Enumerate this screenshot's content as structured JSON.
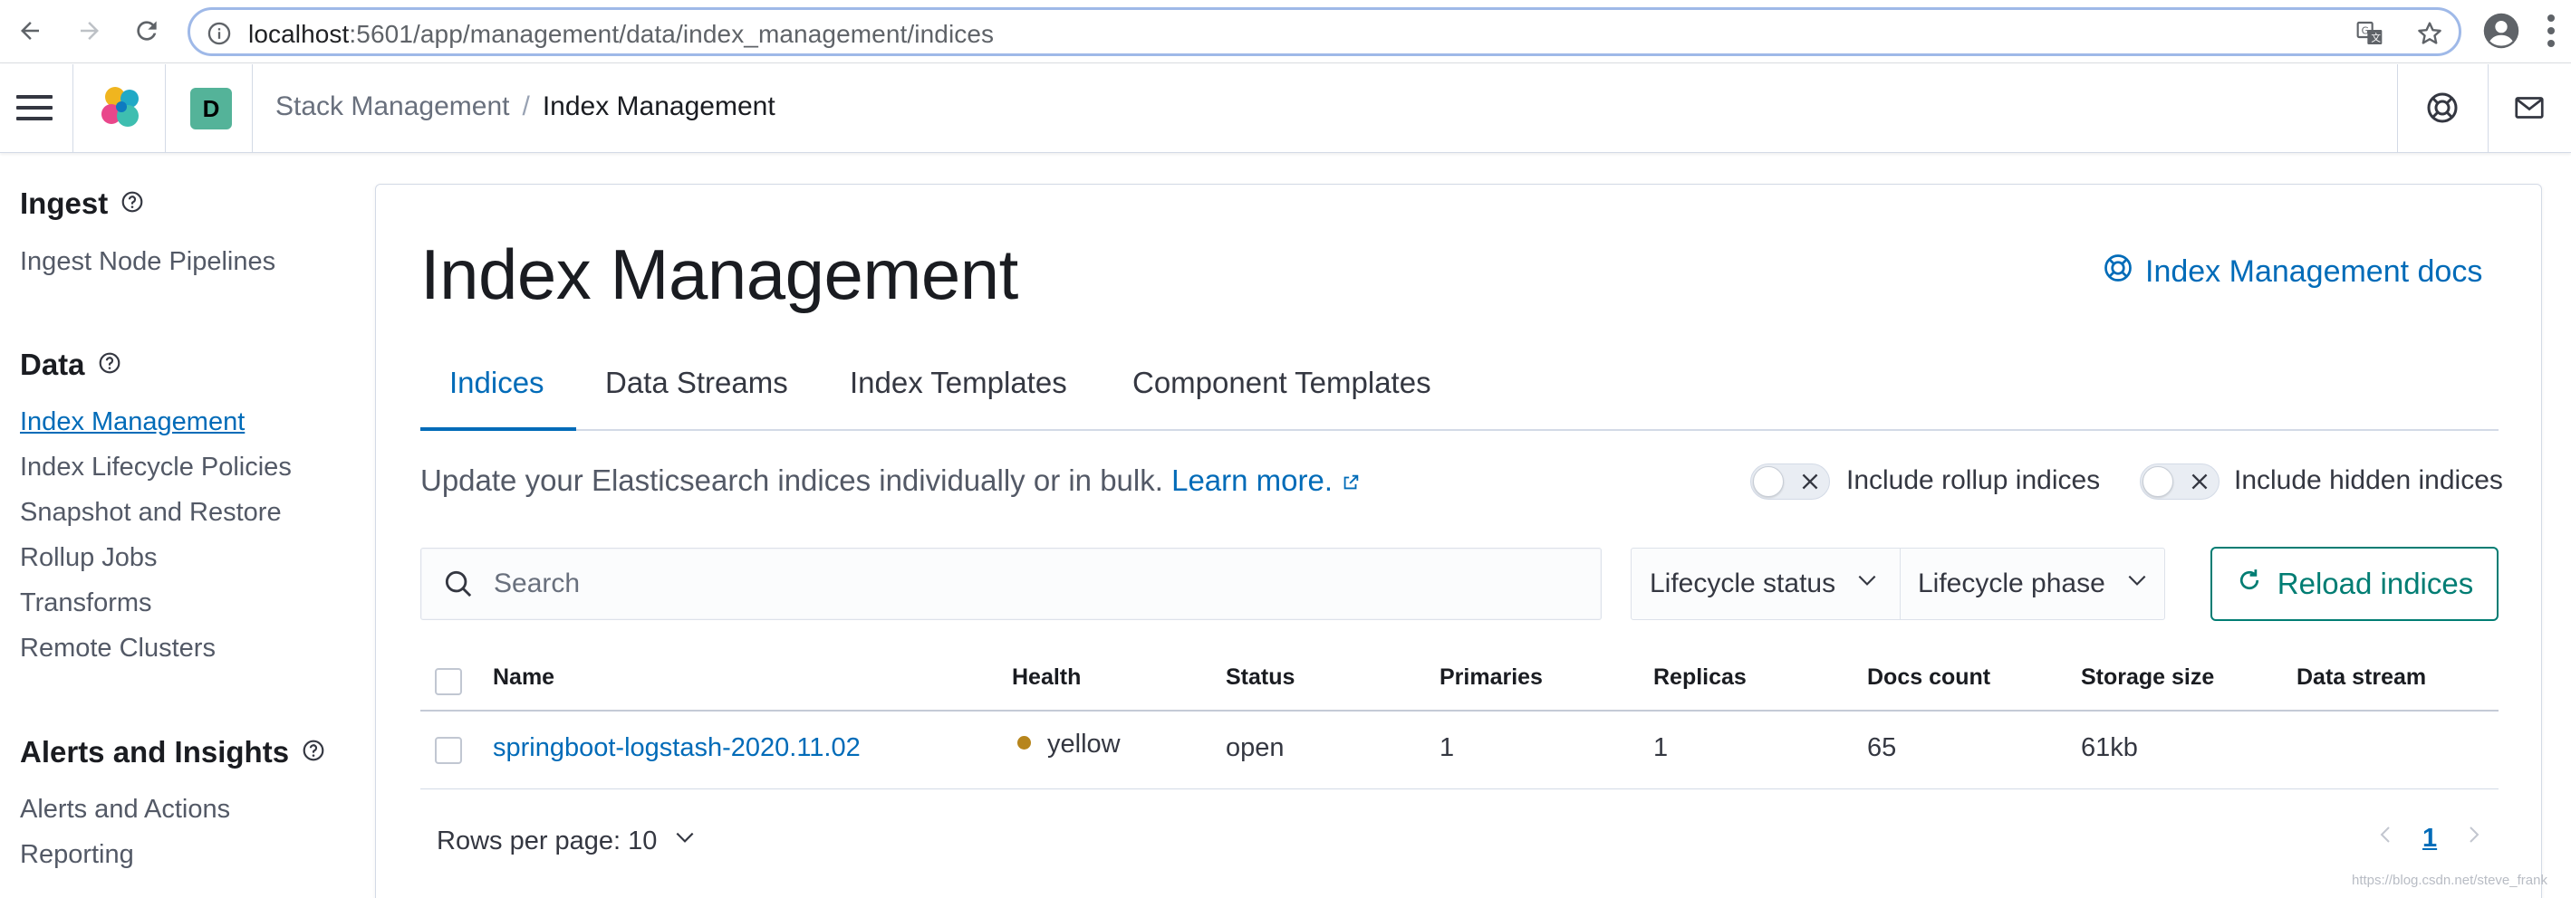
{
  "browser": {
    "url_host": "localhost",
    "url_path": ":5601/app/management/data/index_management/indices"
  },
  "header": {
    "space_initial": "D",
    "breadcrumbs": [
      "Stack Management",
      "Index Management"
    ],
    "crumb_separator": "/"
  },
  "sidebar": {
    "sections": [
      {
        "heading": "Ingest",
        "items": [
          "Ingest Node Pipelines"
        ]
      },
      {
        "heading": "Data",
        "items": [
          "Index Management",
          "Index Lifecycle Policies",
          "Snapshot and Restore",
          "Rollup Jobs",
          "Transforms",
          "Remote Clusters"
        ]
      },
      {
        "heading": "Alerts and Insights",
        "items": [
          "Alerts and Actions",
          "Reporting"
        ]
      }
    ],
    "active_item": "Index Management"
  },
  "main": {
    "title": "Index Management",
    "docs_link": "Index Management docs",
    "tabs": [
      "Indices",
      "Data Streams",
      "Index Templates",
      "Component Templates"
    ],
    "selected_tab": "Indices",
    "description": "Update your Elasticsearch indices individually or in bulk.",
    "learn_more": "Learn more.",
    "toggles": [
      {
        "label": "Include rollup indices",
        "on": false
      },
      {
        "label": "Include hidden indices",
        "on": false
      }
    ],
    "search_placeholder": "Search",
    "filters": [
      "Lifecycle status",
      "Lifecycle phase"
    ],
    "reload_label": "Reload indices"
  },
  "table": {
    "columns": [
      "Name",
      "Health",
      "Status",
      "Primaries",
      "Replicas",
      "Docs count",
      "Storage size",
      "Data stream"
    ],
    "rows": [
      {
        "name": "springboot-logstash-2020.11.02",
        "health": "yellow",
        "status": "open",
        "primaries": "1",
        "replicas": "1",
        "docs_count": "65",
        "storage_size": "61kb",
        "data_stream": ""
      }
    ],
    "rows_per_page_label": "Rows per page: 10",
    "current_page": "1"
  },
  "watermark": "https://blog.csdn.net/steve_frank",
  "colors": {
    "link": "#006bb8",
    "accent_button": "#017d73",
    "health_yellow": "#b7851c"
  },
  "icons": [
    "back-arrow-icon",
    "forward-arrow-icon",
    "reload-icon",
    "info-icon",
    "translate-icon",
    "star-icon",
    "profile-icon",
    "kebab-menu-icon",
    "hamburger-icon",
    "kibana-logo",
    "help-icon",
    "mail-icon",
    "question-circle-icon",
    "docs-help-icon",
    "external-link-icon",
    "close-x-icon",
    "search-icon",
    "chevron-down-icon",
    "refresh-icon",
    "chevron-left-icon",
    "chevron-right-icon"
  ]
}
